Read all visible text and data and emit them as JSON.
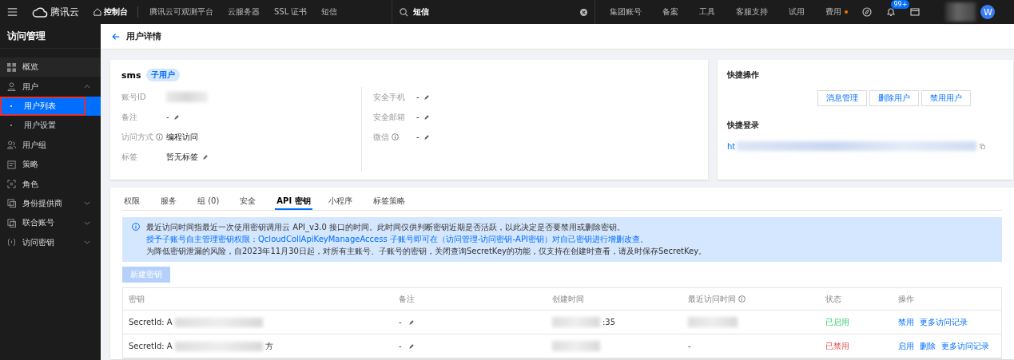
{
  "topbar": {
    "brand": "腾讯云",
    "console": "控制台",
    "links": [
      "腾讯云可观测平台",
      "云服务器",
      "SSL 证书",
      "短信"
    ],
    "search": {
      "value": "短信"
    },
    "right_links": [
      {
        "label": "集团账号",
        "dot": false
      },
      {
        "label": "备案",
        "dot": false
      },
      {
        "label": "工具",
        "dot": false
      },
      {
        "label": "客服支持",
        "dot": false
      },
      {
        "label": "试用",
        "dot": false
      },
      {
        "label": "费用",
        "dot": true
      }
    ],
    "badge": "99+",
    "avatar": "W"
  },
  "sidebar": {
    "title": "访问管理",
    "items": [
      {
        "label": "概览",
        "selected": false,
        "sub": false,
        "outlined": false
      },
      {
        "label": "用户",
        "selected": false,
        "expanded": true,
        "sub": false,
        "outlined": false
      },
      {
        "label": "用户列表",
        "selected": true,
        "sub": true,
        "outlined": true
      },
      {
        "label": "用户设置",
        "selected": false,
        "sub": true,
        "outlined": false
      },
      {
        "label": "用户组",
        "selected": false,
        "sub": false,
        "outlined": false
      },
      {
        "label": "策略",
        "selected": false,
        "sub": false,
        "outlined": false
      },
      {
        "label": "角色",
        "selected": false,
        "sub": false,
        "outlined": false
      },
      {
        "label": "身份提供商",
        "selected": false,
        "expanded": false,
        "sub": false,
        "outlined": false
      },
      {
        "label": "联合账号",
        "selected": false,
        "expanded": false,
        "sub": false,
        "outlined": false
      },
      {
        "label": "访问密钥",
        "selected": false,
        "expanded": false,
        "sub": false,
        "outlined": false
      }
    ]
  },
  "page": {
    "title": "用户详情"
  },
  "user": {
    "name": "sms",
    "tag": "子用户",
    "left_fields": [
      {
        "label": "账号ID",
        "info": false,
        "edit": false,
        "redacted": true
      },
      {
        "label": "备注",
        "value": "-",
        "info": false,
        "edit": true,
        "redacted": false
      },
      {
        "label": "访问方式",
        "value": "编程访问",
        "info": true,
        "edit": false,
        "redacted": false
      },
      {
        "label": "标签",
        "value": "暂无标签",
        "info": false,
        "edit": true,
        "redacted": false
      }
    ],
    "right_fields": [
      {
        "label": "安全手机",
        "value": "-",
        "info": false,
        "edit": true
      },
      {
        "label": "安全邮箱",
        "value": "-",
        "info": false,
        "edit": true
      },
      {
        "label": "微信",
        "value": "-",
        "info": true,
        "edit": true
      }
    ]
  },
  "quick": {
    "title": "快捷操作",
    "buttons": [
      "消息管理",
      "删除用户",
      "禁用用户"
    ],
    "login_title": "快捷登录",
    "login_link": "ht"
  },
  "tabs": [
    {
      "label": "权限",
      "selected": false
    },
    {
      "label": "服务",
      "selected": false
    },
    {
      "label": "组 (0)",
      "selected": false
    },
    {
      "label": "安全",
      "selected": false
    },
    {
      "label": "API 密钥",
      "selected": true
    },
    {
      "label": "小程序",
      "selected": false
    },
    {
      "label": "标签策略",
      "selected": false
    }
  ],
  "notice": [
    "最近访问时间指最近一次使用密钥调用云 API_v3.0 接口的时间。此时间仅供判断密钥近期是否活跃，以此决定是否要禁用或删除密钥。",
    "授予子账号自主管理密钥权限：QcloudCollApiKeyManageAccess 子账号即可在（访问管理-访问密钥-API密钥）对自己密钥进行增删改查。",
    "为降低密钥泄漏的风险，自2023年11月30日起，对所有主账号、子账号的密钥，关闭查询SecretKey的功能，仅支持在创建时查看，请及时保存SecretKey。"
  ],
  "create_button": {
    "label": "新建密钥",
    "disabled": true
  },
  "table": {
    "columns": [
      {
        "label": "密钥",
        "info": false
      },
      {
        "label": "备注",
        "info": false
      },
      {
        "label": "创建时间",
        "info": false
      },
      {
        "label": "最近访问时间",
        "info": true
      },
      {
        "label": "状态",
        "info": false
      },
      {
        "label": "操作",
        "info": false
      }
    ],
    "rows": [
      {
        "key": "SecretId: A",
        "note": "-",
        "created": ":35",
        "last_redacted": true,
        "status": "已启用",
        "enabled": true,
        "actions": [
          "禁用",
          "更多访问记录"
        ]
      },
      {
        "key": "SecretId: A",
        "key_tail": "方",
        "note": "-",
        "last_access": "-",
        "last_redacted": false,
        "status": "已禁用",
        "enabled": false,
        "actions": [
          "启用",
          "删除",
          "更多访问记录"
        ]
      }
    ]
  }
}
